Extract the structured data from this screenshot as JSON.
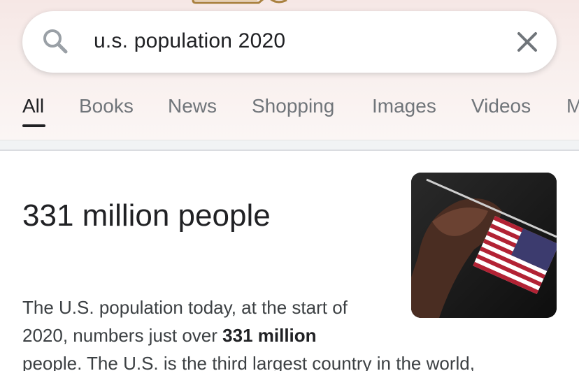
{
  "search": {
    "query": "u.s. population 2020"
  },
  "tabs": [
    {
      "label": "All",
      "active": true
    },
    {
      "label": "Books"
    },
    {
      "label": "News"
    },
    {
      "label": "Shopping"
    },
    {
      "label": "Images"
    },
    {
      "label": "Videos"
    },
    {
      "label": "M"
    }
  ],
  "answer": {
    "title": "331 million people",
    "line1": "The U.S. population today, at the start of",
    "line2_pre": "2020, numbers just over ",
    "line2_bold": "331 million",
    "line3": "people. The U.S. is the third largest country in the world,"
  },
  "colors": {
    "accent": "#202124",
    "tab_inactive": "#70757a",
    "header_tint": "#f6e7e5"
  }
}
